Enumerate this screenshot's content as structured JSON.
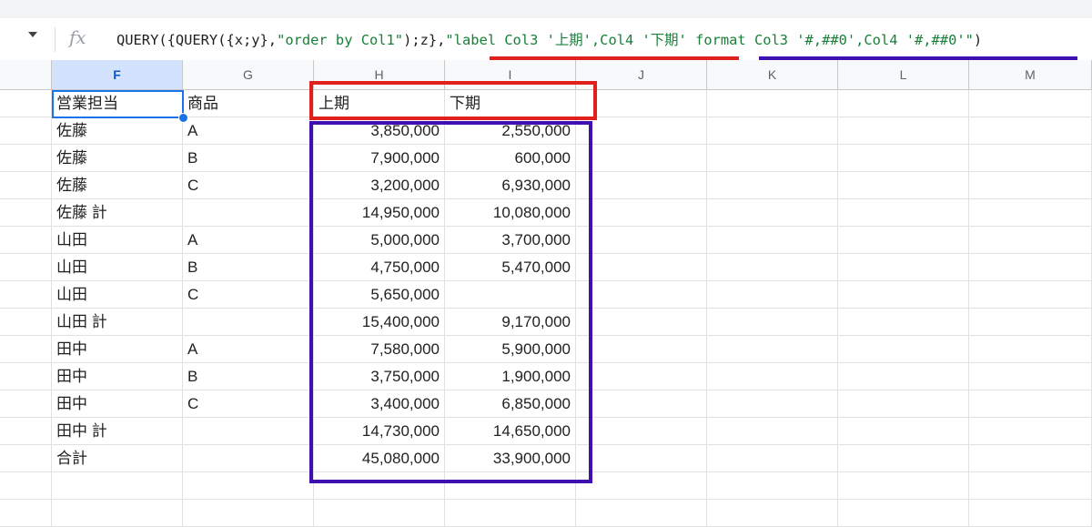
{
  "formula_bar": {
    "fx_icon": "fx-icon",
    "tokens": [
      {
        "t": "QUERY({QUERY({x;y},",
        "kind": "plain"
      },
      {
        "t": "\"order by Col1\"",
        "kind": "str"
      },
      {
        "t": ");z},",
        "kind": "plain"
      },
      {
        "t": "\"label Col3 '上期',Col4 '下期' format Col3 '#,##0',Col4 '#,##0'\"",
        "kind": "str"
      },
      {
        "t": ")",
        "kind": "plain"
      }
    ]
  },
  "columns": [
    "F",
    "G",
    "H",
    "I",
    "J",
    "K",
    "L",
    "M"
  ],
  "selected_column": "F",
  "rows": [
    [
      "営業担当",
      "商品",
      "上期",
      "下期",
      "",
      "",
      "",
      ""
    ],
    [
      "佐藤",
      "A",
      "3,850,000",
      "2,550,000",
      "",
      "",
      "",
      ""
    ],
    [
      "佐藤",
      "B",
      "7,900,000",
      "600,000",
      "",
      "",
      "",
      ""
    ],
    [
      "佐藤",
      "C",
      "3,200,000",
      "6,930,000",
      "",
      "",
      "",
      ""
    ],
    [
      "佐藤 計",
      "",
      "14,950,000",
      "10,080,000",
      "",
      "",
      "",
      ""
    ],
    [
      "山田",
      "A",
      "5,000,000",
      "3,700,000",
      "",
      "",
      "",
      ""
    ],
    [
      "山田",
      "B",
      "4,750,000",
      "5,470,000",
      "",
      "",
      "",
      ""
    ],
    [
      "山田",
      "C",
      "5,650,000",
      "",
      "",
      "",
      "",
      ""
    ],
    [
      "山田 計",
      "",
      "15,400,000",
      "9,170,000",
      "",
      "",
      "",
      ""
    ],
    [
      "田中",
      "A",
      "7,580,000",
      "5,900,000",
      "",
      "",
      "",
      ""
    ],
    [
      "田中",
      "B",
      "3,750,000",
      "1,900,000",
      "",
      "",
      "",
      ""
    ],
    [
      "田中",
      "C",
      "3,400,000",
      "6,850,000",
      "",
      "",
      "",
      ""
    ],
    [
      "田中 計",
      "",
      "14,730,000",
      "14,650,000",
      "",
      "",
      "",
      ""
    ],
    [
      "合計",
      "",
      "45,080,000",
      "33,900,000",
      "",
      "",
      "",
      ""
    ],
    [
      "",
      "",
      "",
      "",
      "",
      "",
      "",
      ""
    ],
    [
      "",
      "",
      "",
      "",
      "",
      "",
      "",
      ""
    ]
  ],
  "colors": {
    "red_annotation": "#e0201c",
    "purple_annotation": "#3f0fb2",
    "selection": "#1a73e8",
    "formula_string": "#188038"
  }
}
